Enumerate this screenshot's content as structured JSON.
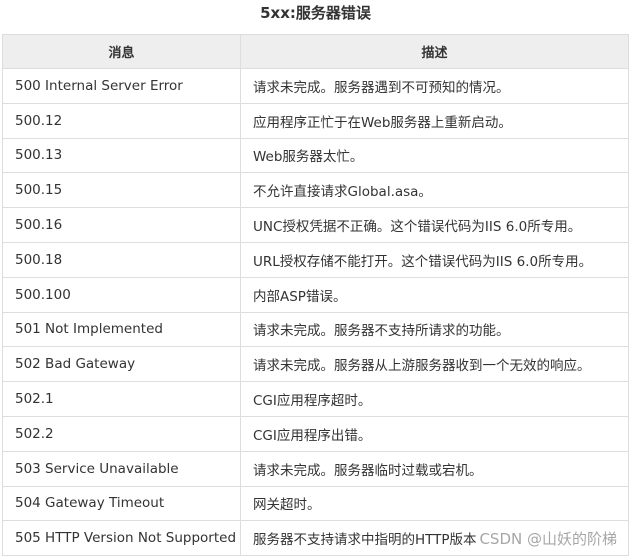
{
  "title": "5xx:服务器错误",
  "table": {
    "headers": [
      "消息",
      "描述"
    ],
    "rows": [
      [
        "500 Internal Server Error",
        "请求未完成。服务器遇到不可预知的情况。"
      ],
      [
        "500.12",
        "应用程序正忙于在Web服务器上重新启动。"
      ],
      [
        "500.13",
        "Web服务器太忙。"
      ],
      [
        "500.15",
        "不允许直接请求Global.asa。"
      ],
      [
        "500.16",
        "UNC授权凭据不正确。这个错误代码为IIS 6.0所专用。"
      ],
      [
        "500.18",
        "URL授权存储不能打开。这个错误代码为IIS 6.0所专用。"
      ],
      [
        "500.100",
        "内部ASP错误。"
      ],
      [
        "501 Not Implemented",
        "请求未完成。服务器不支持所请求的功能。"
      ],
      [
        "502 Bad Gateway",
        "请求未完成。服务器从上游服务器收到一个无效的响应。"
      ],
      [
        "502.1",
        "CGI应用程序超时。"
      ],
      [
        "502.2",
        "CGI应用程序出错。"
      ],
      [
        "503 Service Unavailable",
        "请求未完成。服务器临时过载或宕机。"
      ],
      [
        "504 Gateway Timeout",
        "网关超时。"
      ],
      [
        "505 HTTP Version Not Supported",
        "服务器不支持请求中指明的HTTP版本"
      ]
    ]
  },
  "watermark": "CSDN @山妖的阶梯"
}
